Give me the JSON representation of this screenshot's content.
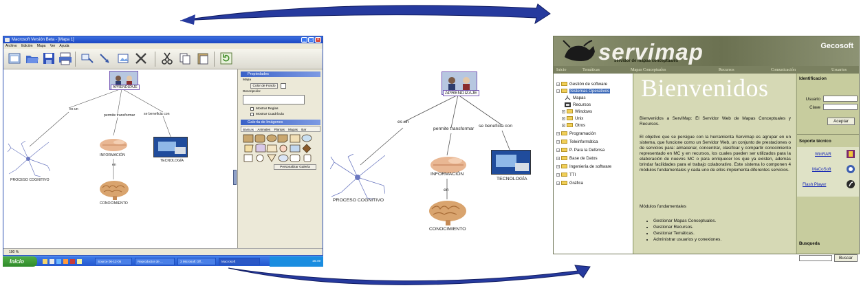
{
  "editor": {
    "title": "Macrosoft Versión Beta - [Mapa 1]",
    "menu": [
      "Archivo",
      "Edición",
      "Mapa",
      "Ver",
      "Ayuda"
    ],
    "panel": {
      "props_title": "Propiedades",
      "section_label": "Mapa",
      "bg_color_button": "Color de Fondo",
      "desc_label": "Descripción:",
      "show_rulers": "Mostrar Reglas",
      "show_grid": "Mostrar Cuadrícula",
      "gallery_title": "Galería de Imágenes",
      "gallery_tabs": [
        "Básicas",
        "Animales",
        "Plantas",
        "Mapas",
        "Bar"
      ],
      "customize_button": "Personalizar Galería"
    },
    "zoom": "100 %",
    "taskbar": {
      "start": "Inicio",
      "tasks": [
        "Source 06-12-05",
        "Reproductor de ...",
        "3 Microsoft Off...",
        "Macrosoft"
      ],
      "clock": "16:49"
    }
  },
  "concept_map": {
    "root": "APRENDIZAJE",
    "links": [
      "es un",
      "permite transformar",
      "se beneficia con",
      "en"
    ],
    "nodes": [
      "PROCESO COGNITIVO",
      "INFORMACIÓN",
      "TECNOLOGÍA",
      "CONOCIMIENTO"
    ]
  },
  "servimap": {
    "logo": "servimap",
    "subtitle": "servidor de mapas conceptuales",
    "brand": "Gecosoft",
    "nav": [
      "Inicio",
      "Temáticas",
      "Mapas Conceptuales",
      "Recursos",
      "Comunicación",
      "Usuarios"
    ],
    "tree": [
      {
        "label": "Gestión de software",
        "level": 0
      },
      {
        "label": "Sistemas Operativos",
        "level": 0,
        "selected": true
      },
      {
        "label": "Mapas",
        "level": 1
      },
      {
        "label": "Recursos",
        "level": 1
      },
      {
        "label": "Windows",
        "level": 1
      },
      {
        "label": "Unix",
        "level": 1
      },
      {
        "label": "Otros",
        "level": 1
      },
      {
        "label": "Programación",
        "level": 0
      },
      {
        "label": "Teleinformática",
        "level": 0
      },
      {
        "label": "P. Para la Defensa",
        "level": 0
      },
      {
        "label": "Base de Datos",
        "level": 0
      },
      {
        "label": "Ingeniería de software",
        "level": 0
      },
      {
        "label": "TTI",
        "level": 0
      },
      {
        "label": "Gráfica",
        "level": 0
      }
    ],
    "welcome": "Bienvenidos",
    "intro": "Bienvenidos a ServiMap: El Servidor Web de Mapas Conceptuales y Recursos.",
    "objective": "El objetivo que se persigue con la herramienta Servimap es agrupar en un sistema, que funcione como un Servidor Web, un conjunto de prestaciones o de servicios para: almacenar, concentrar, clasificar y compartir conocimiento representado en MC y en recursos, los cuales pueden ser utilizados para la elaboración de nuevos MC o para enriquecer los que ya existen, además brindar facilidades para el trabajo colaborativo. Este sistema lo componen 4 módulos fundamentales y cada uno de ellos implementa diferentes servicios.",
    "modules_title": "Módulos fundamentales",
    "modules": [
      "Gestionar Mapas Conceptuales.",
      "Gestionar Recursos.",
      "Gestionar Temáticas.",
      "Administrar usuarios y conexiones."
    ],
    "login": {
      "title": "Identificacion",
      "user_label": "Usuario",
      "password_label": "Clave",
      "button": "Aceptar"
    },
    "support": {
      "title": "Soporte técnico",
      "links": [
        "WinRAR",
        "MaCoSoft",
        "Flash Player"
      ]
    },
    "search": {
      "title": "Busqueda",
      "button": "Buscar"
    }
  },
  "colors": {
    "arrow_fill": "#263a9e",
    "window_blue": "#2458d0",
    "site_olive": "#7a8060",
    "site_bg": "#c9d0a3"
  }
}
